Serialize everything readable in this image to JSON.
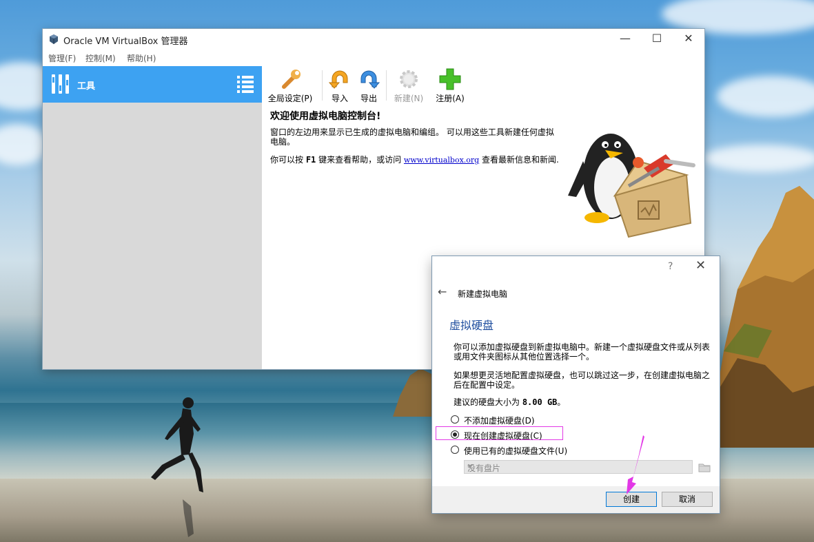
{
  "main_window": {
    "title": "Oracle VM VirtualBox 管理器",
    "controls": {
      "minimize": "—",
      "maximize": "☐",
      "close": "✕"
    },
    "menu": [
      "管理(F)",
      "控制(M)",
      "帮助(H)"
    ]
  },
  "sidebar": {
    "tools_label": "工具"
  },
  "toolbar": [
    {
      "label": "全局设定(P)",
      "icon": "wrench-icon",
      "enabled": true
    },
    {
      "label": "导入",
      "icon": "import-icon",
      "enabled": true
    },
    {
      "label": "导出",
      "icon": "export-icon",
      "enabled": true
    },
    {
      "label": "新建(N)",
      "icon": "new-gear-icon",
      "enabled": false
    },
    {
      "label": "注册(A)",
      "icon": "add-plus-icon",
      "enabled": true
    }
  ],
  "welcome": {
    "title": "欢迎使用虚拟电脑控制台!",
    "p1": "窗口的左边用来显示已生成的虚拟电脑和编组。 可以用这些工具新建任何虚拟电脑。",
    "p2_a": "你可以按 ",
    "p2_key": "F1",
    "p2_b": " 键来查看帮助，或访问 ",
    "p2_link": "www.virtualbox.org",
    "p2_c": " 查看最新信息和新闻."
  },
  "dialog": {
    "help": "?",
    "close": "✕",
    "wizard_title": "新建虚拟电脑",
    "section_title": "虚拟硬盘",
    "p1": "你可以添加虚拟硬盘到新虚拟电脑中。新建一个虚拟硬盘文件或从列表或用文件夹图标从其他位置选择一个。",
    "p2": "如果想更灵活地配置虚拟硬盘，也可以跳过这一步，在创建虚拟电脑之后在配置中设定。",
    "recommend_a": "建议的硬盘大小为 ",
    "recommend_size": "8.00 GB",
    "recommend_b": "。",
    "options": [
      {
        "label": "不添加虚拟硬盘(D)",
        "selected": false
      },
      {
        "label": "现在创建虚拟硬盘(C)",
        "selected": true
      },
      {
        "label": "使用已有的虚拟硬盘文件(U)",
        "selected": false
      }
    ],
    "disk_combo": "没有盘片",
    "create_button": "创建",
    "cancel_button": "取消"
  },
  "colors": {
    "accent": "#3da2f2",
    "highlight": "#e238e6",
    "section_title": "#1e4d9e"
  }
}
